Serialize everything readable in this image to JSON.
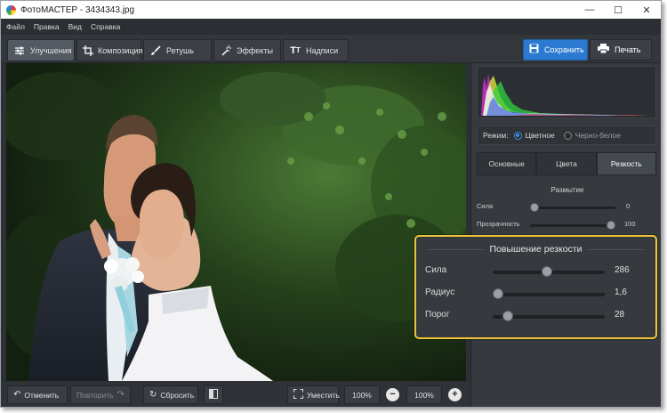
{
  "window": {
    "title": "ФотоМАСТЕР - 3434343.jpg",
    "controls": [
      "minimize-icon",
      "maximize-icon",
      "close-icon"
    ]
  },
  "menu": [
    "Файл",
    "Правка",
    "Вид",
    "Справка"
  ],
  "toolbar": {
    "tabs": [
      {
        "label": "Улучшения",
        "icon": "sliders-icon",
        "active": true
      },
      {
        "label": "Композиция",
        "icon": "crop-icon",
        "active": false
      },
      {
        "label": "Ретушь",
        "icon": "brush-icon",
        "active": false
      },
      {
        "label": "Эффекты",
        "icon": "magic-wand-icon",
        "active": false
      },
      {
        "label": "Надписи",
        "icon": "text-icon",
        "active": false
      }
    ],
    "save_label": "Сохранить",
    "print_label": "Печать"
  },
  "bottom": {
    "undo_label": "Отменить",
    "redo_label": "Повторить",
    "reset_label": "Сбросить",
    "fit_label": "Уместить",
    "zoom_fit": "100%",
    "zoom_current": "100%"
  },
  "panel": {
    "mode_label": "Режим:",
    "mode_color": "Цветное",
    "mode_bw": "Черно-белое",
    "mode_selected": "Цветное",
    "tabs": [
      {
        "label": "Основные",
        "active": false
      },
      {
        "label": "Цвета",
        "active": false
      },
      {
        "label": "Резкость",
        "active": true
      }
    ],
    "blur": {
      "title": "Размытие",
      "sliders": [
        {
          "label": "Сила",
          "value": "0",
          "level": 0.0
        },
        {
          "label": "Прозрачность",
          "value": "100",
          "level": 1.0
        }
      ]
    },
    "sharpen": {
      "title": "Повышение резкости",
      "sliders": [
        {
          "label": "Сила",
          "value": "286",
          "level": 0.48
        },
        {
          "label": "Радиус",
          "value": "1,6",
          "level": 0.0
        },
        {
          "label": "Порог",
          "value": "28",
          "level": 0.1
        }
      ]
    }
  },
  "colors": {
    "accent": "#2b79d1",
    "highlight_border": "#f0c437",
    "panel_bg": "#363a3f",
    "app_bg": "#2d3034"
  }
}
